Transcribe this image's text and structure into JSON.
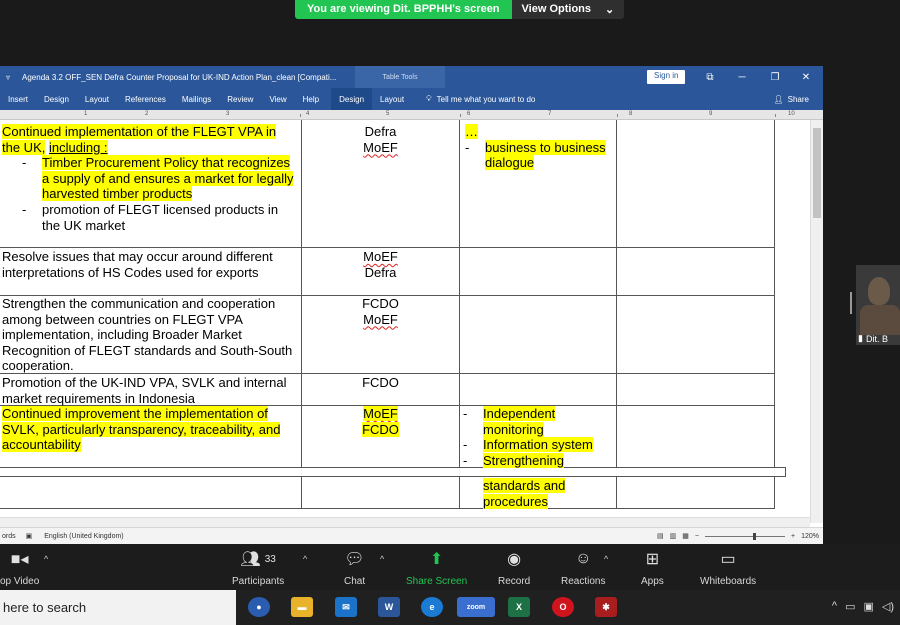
{
  "share_banner": {
    "viewing_text": "You are viewing Dit. BPPHH's screen",
    "view_options": "View Options"
  },
  "word": {
    "title": "Agenda 3.2 OFF_SEN Defra Counter Proposal for UK-IND Action Plan_clean [Compati...",
    "table_tools": "Table Tools",
    "sign_in": "Sign in",
    "ribbon_tabs": [
      "Insert",
      "Design",
      "Layout",
      "References",
      "Mailings",
      "Review",
      "View",
      "Help",
      "Design",
      "Layout"
    ],
    "tell_me": "Tell me what you want to do",
    "share": "Share",
    "ruler_numbers": [
      "1",
      "2",
      "3",
      "4",
      "5",
      "6",
      "7",
      "8",
      "9",
      "10"
    ],
    "status_left": "ords",
    "status_language": "English (United Kingdom)",
    "zoom_percent": "120%"
  },
  "table": {
    "row1": {
      "lead": "Continued implementation of the FLEGT VPA in the UK,",
      "lead_link": "including :",
      "bullets": [
        {
          "dash": "-",
          "text": "Timber Procurement Policy that recognizes a supply of and ensures a market for legally harvested timber products",
          "highlight": true
        },
        {
          "dash": "-",
          "text": "promotion of FLEGT licensed products in the UK market",
          "highlight": false
        }
      ],
      "orgs": [
        "Defra",
        "MoEF"
      ],
      "ellipsis": "…",
      "outputs": [
        {
          "dash": "-",
          "text": "business to business dialogue"
        }
      ]
    },
    "row2": {
      "activity": "Resolve issues that may occur around different interpretations of HS Codes used for exports",
      "orgs": [
        "MoEF",
        "Defra"
      ]
    },
    "row3": {
      "activity": "Strengthen the communication and cooperation among between countries on FLEGT VPA implementation, including Broader Market Recognition of FLEGT standards and South-South cooperation.",
      "orgs": [
        "FCDO",
        "MoEF"
      ]
    },
    "row4": {
      "activity": "Promotion of the UK-IND VPA, SVLK and internal market requirements in Indonesia",
      "orgs": [
        "FCDO"
      ]
    },
    "row5": {
      "activity": "Continued improvement the implementation of SVLK, particularly transparency, traceability, and accountability",
      "orgs": [
        "MoEF",
        "FCDO"
      ],
      "outputs": [
        {
          "dash": "-",
          "text": "Independent monitoring"
        },
        {
          "dash": "-",
          "text": "Information system"
        },
        {
          "dash": "-",
          "text": "Strengthening"
        }
      ]
    },
    "row6": {
      "continuation": "standards and procedures"
    }
  },
  "participant_thumbnail": {
    "name": "Dit. B"
  },
  "zoom_toolbar": {
    "video": "op Video",
    "participants": "Participants",
    "participants_count": "33",
    "chat": "Chat",
    "share_screen": "Share Screen",
    "record": "Record",
    "reactions": "Reactions",
    "apps": "Apps",
    "whiteboards": "Whiteboards"
  },
  "taskbar": {
    "search": "here to search",
    "zoom_label": "zoom"
  },
  "colors": {
    "word_blue": "#2b579a",
    "highlight": "#ffff00",
    "zoom_green": "#23c552"
  }
}
